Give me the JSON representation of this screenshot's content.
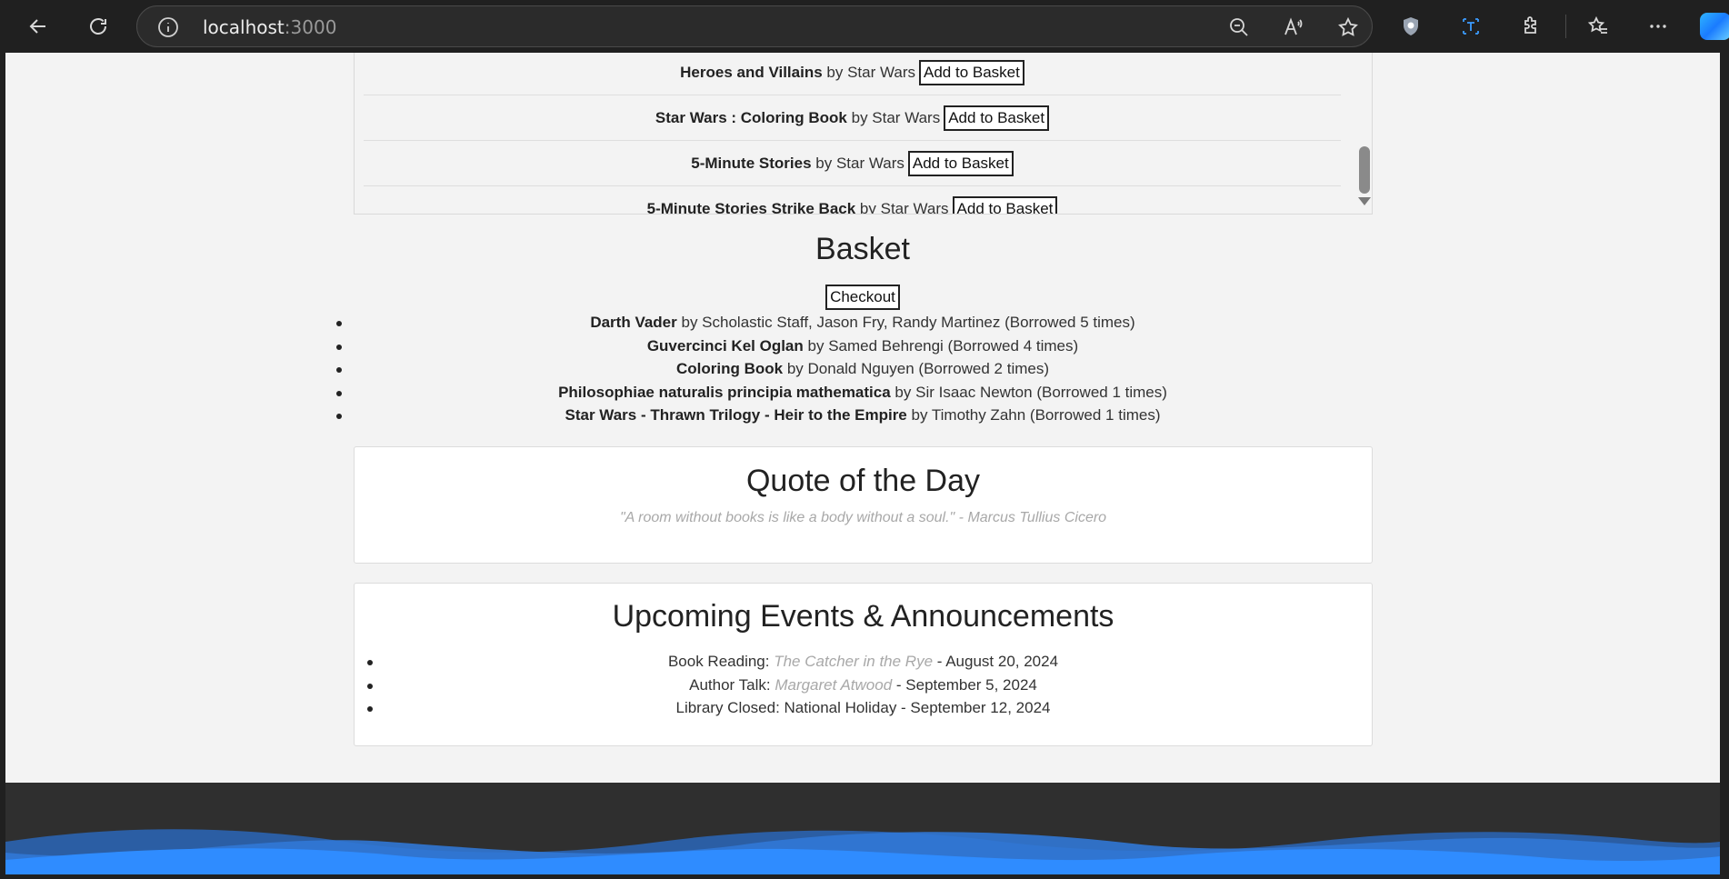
{
  "browser": {
    "url_host": "localhost",
    "url_port": ":3000",
    "icons": [
      "back-icon",
      "refresh-icon",
      "info-icon",
      "zoom-out-icon",
      "read-aloud-icon",
      "favorite-star-icon",
      "shield-icon",
      "translate-icon",
      "extensions-icon",
      "favorites-icon",
      "more-icon",
      "copilot-icon"
    ]
  },
  "catalog": {
    "rows": [
      {
        "title": "Heroes and Villains",
        "by": "by Star Wars",
        "button": "Add to Basket"
      },
      {
        "title": "Star Wars : Coloring Book",
        "by": "by Star Wars",
        "button": "Add to Basket"
      },
      {
        "title": "5-Minute Stories",
        "by": "by Star Wars",
        "button": "Add to Basket"
      },
      {
        "title": "5-Minute Stories Strike Back",
        "by": "by Star Wars",
        "button": "Add to Basket"
      }
    ]
  },
  "basket": {
    "title": "Basket",
    "checkout_label": "Checkout",
    "items": [
      {
        "title": "Darth Vader",
        "rest": "by Scholastic Staff, Jason Fry, Randy Martinez (Borrowed 5 times)"
      },
      {
        "title": "Guvercinci Kel Oglan",
        "rest": "by Samed Behrengi (Borrowed 4 times)"
      },
      {
        "title": "Coloring Book",
        "rest": "by Donald Nguyen (Borrowed 2 times)"
      },
      {
        "title": "Philosophiae naturalis principia mathematica",
        "rest": "by Sir Isaac Newton (Borrowed 1 times)"
      },
      {
        "title": "Star Wars - Thrawn Trilogy - Heir to the Empire",
        "rest": "by Timothy Zahn (Borrowed 1 times)"
      }
    ]
  },
  "quote": {
    "title": "Quote of the Day",
    "text": "\"A room without books is like a body without a soul.\" - Marcus Tullius Cicero"
  },
  "events": {
    "title": "Upcoming Events & Announcements",
    "items": [
      {
        "prefix": "Book Reading:",
        "italic": "The Catcher in the Rye",
        "suffix": "- August 20, 2024"
      },
      {
        "prefix": "Author Talk:",
        "italic": "Margaret Atwood",
        "suffix": "- September 5, 2024"
      },
      {
        "prefix": "Library Closed: National Holiday - September 12, 2024",
        "italic": "",
        "suffix": ""
      }
    ]
  },
  "colors": {
    "chrome_bg": "#202020",
    "page_bg": "#f3f3f3",
    "footer_bg": "#2f2f2f",
    "wave": "#2f8cff"
  }
}
